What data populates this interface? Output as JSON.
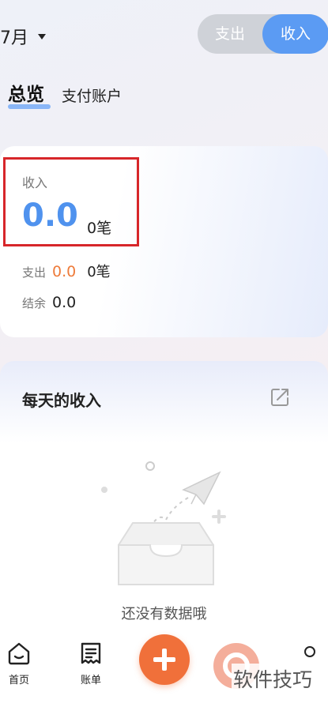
{
  "header": {
    "month": "7月",
    "toggle": {
      "expense": "支出",
      "income": "收入",
      "selected": "income"
    }
  },
  "tabs": {
    "overview": "总览",
    "accounts": "支付账户"
  },
  "summary": {
    "income_label": "收入",
    "income_value": "0.0",
    "income_count": "0笔",
    "expense_label": "支出",
    "expense_value": "0.0",
    "expense_count": "0笔",
    "balance_label": "结余",
    "balance_value": "0.0"
  },
  "daily": {
    "title": "每天的收入",
    "empty_text": "还没有数据哦"
  },
  "nav": {
    "home": "首页",
    "ledger": "账单"
  },
  "watermark": "软件技巧",
  "colors": {
    "accent_blue": "#5b9bf3",
    "accent_orange": "#f0703a",
    "highlight_red": "#d7262a"
  }
}
